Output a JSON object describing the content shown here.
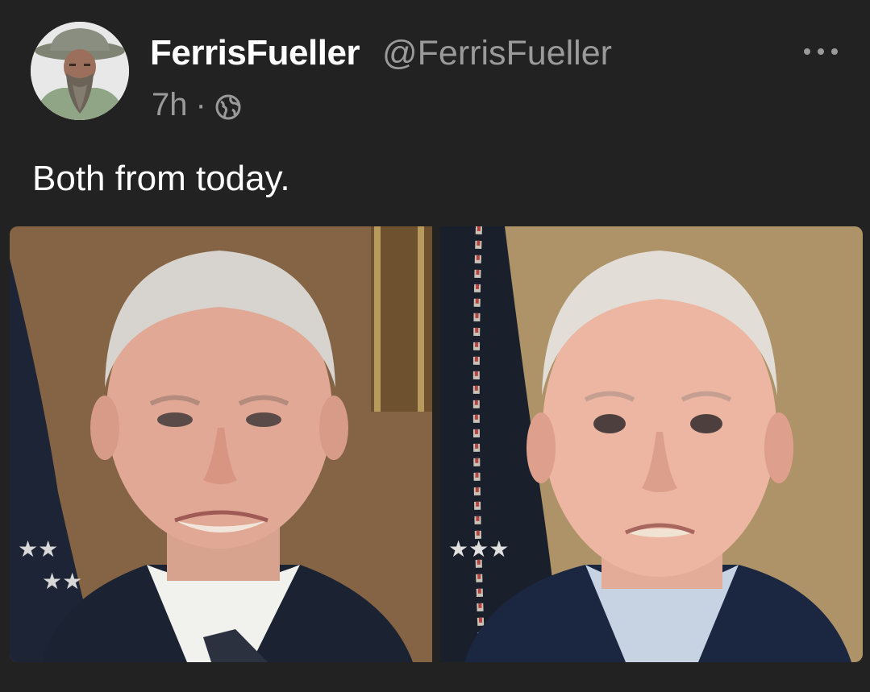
{
  "post": {
    "author_name": "FerrisFueller",
    "author_handle": "@FerrisFueller",
    "time": "7h",
    "separator": "·",
    "visibility_icon": "globe-icon",
    "more_icon": "more-options-icon",
    "text": "Both from today.",
    "media": [
      {
        "name": "left-photo",
        "description_icon": "photo"
      },
      {
        "name": "right-photo",
        "description_icon": "photo"
      }
    ]
  },
  "colors": {
    "background": "#222222",
    "primary_text": "#ffffff",
    "secondary_text": "#9a9a9a"
  }
}
